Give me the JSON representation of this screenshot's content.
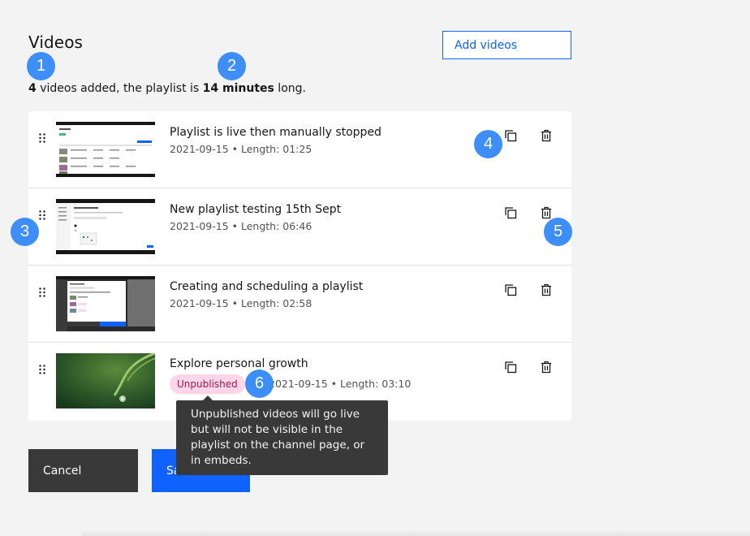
{
  "header": {
    "title": "Videos",
    "add_button_label": "Add videos"
  },
  "summary": {
    "count": "4",
    "text_mid": " videos added, the playlist is ",
    "duration": "14 minutes",
    "text_end": " long."
  },
  "videos": [
    {
      "title": "Playlist is live then manually stopped",
      "meta": "2021-09-15 • Length: 01:25"
    },
    {
      "title": "New playlist testing 15th Sept",
      "meta": "2021-09-15 • Length: 06:46"
    },
    {
      "title": "Creating and scheduling a playlist",
      "meta": "2021-09-15 • Length: 02:58"
    },
    {
      "title": "Explore personal growth",
      "meta": "2021-09-15 • Length: 03:10",
      "tag": "Unpublished"
    }
  ],
  "tooltip": {
    "text": "Unpublished videos will go live but will not be visible in the playlist on the channel page, or in embeds."
  },
  "footer": {
    "cancel_label": "Cancel",
    "save_label": "Save"
  },
  "badges": [
    "1",
    "2",
    "3",
    "4",
    "5",
    "6"
  ],
  "colors": {
    "primary": "#0f62fe",
    "badge": "#3e8ef7",
    "tag_bg": "#ffd6e8",
    "tag_text": "#9f1853",
    "dark_button": "#393939"
  }
}
